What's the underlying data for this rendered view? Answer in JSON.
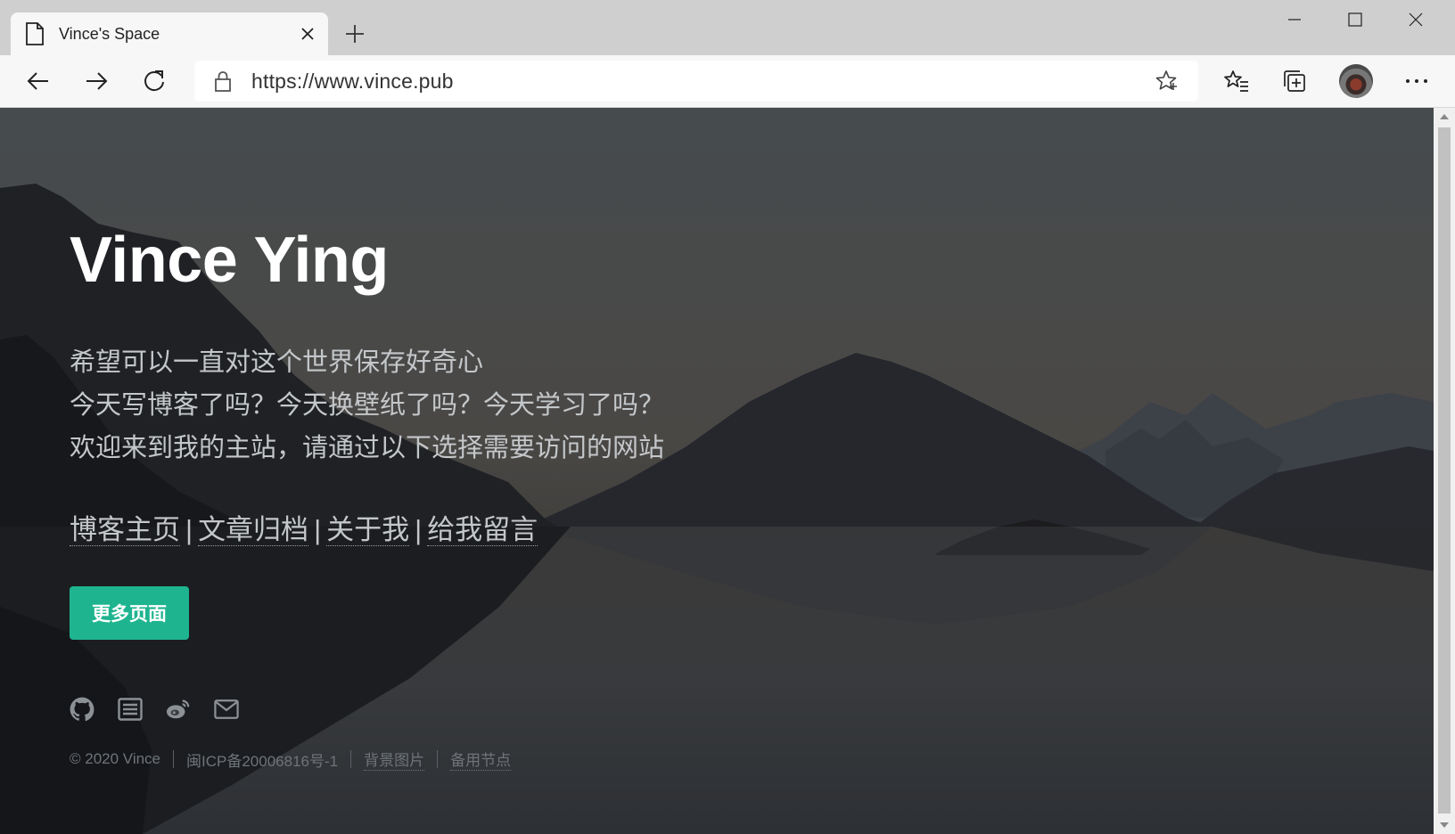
{
  "browser": {
    "tab_title": "Vince's Space",
    "url": "https://www.vince.pub"
  },
  "hero": {
    "title": "Vince Ying",
    "lines": [
      "希望可以一直对这个世界保存好奇心",
      "今天写博客了吗？今天换壁纸了吗？今天学习了吗？",
      "欢迎来到我的主站，请通过以下选择需要访问的网站"
    ]
  },
  "links": [
    "博客主页",
    "文章归档",
    "关于我",
    "给我留言"
  ],
  "link_separator": "|",
  "more_button": "更多页面",
  "social_icons": [
    "github-icon",
    "list-icon",
    "weibo-icon",
    "mail-icon"
  ],
  "footer": {
    "copyright": "© 2020 Vince",
    "icp": "闽ICP备20006816号-1",
    "background_image": "背景图片",
    "backup_node": "备用节点"
  },
  "colors": {
    "accent": "#1fb490",
    "title": "#ffffff",
    "text": "#c4c7ca",
    "footer": "#6e7479"
  }
}
